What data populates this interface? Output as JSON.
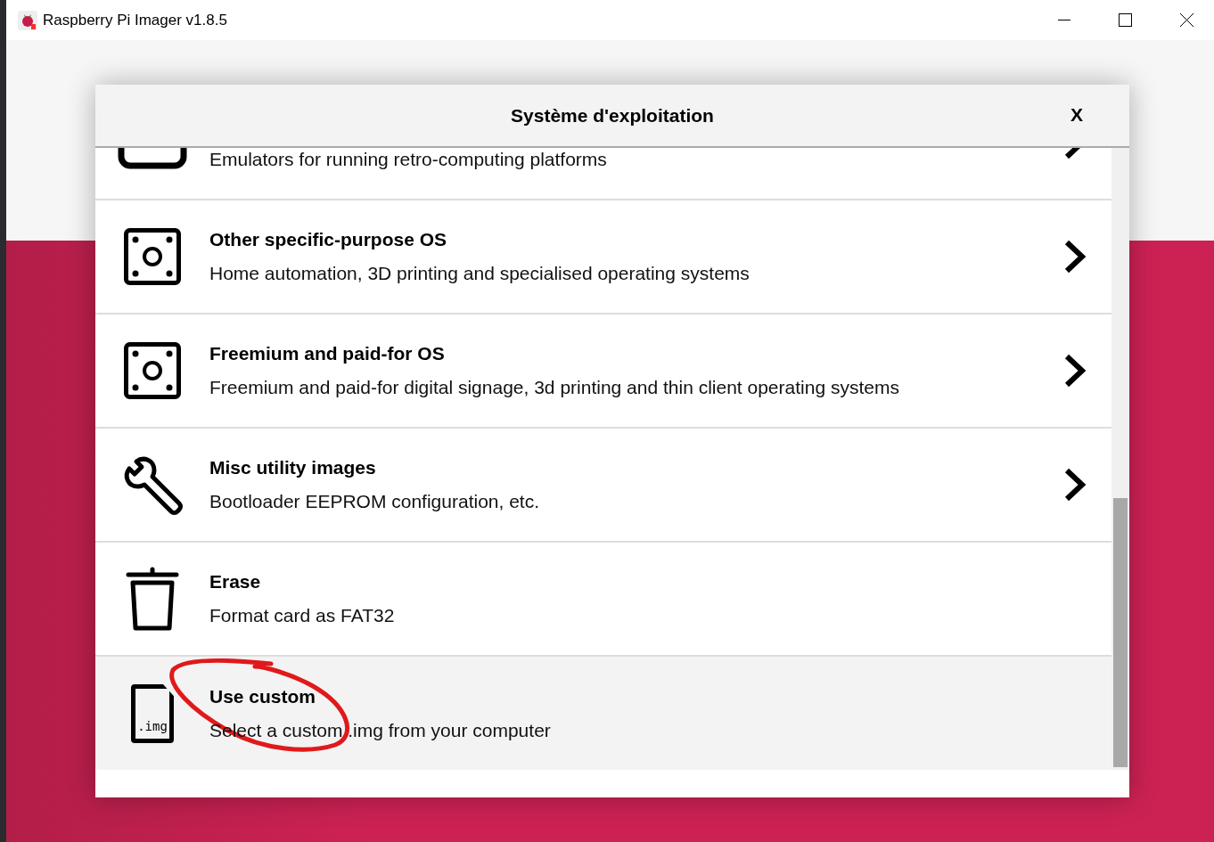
{
  "window": {
    "title": "Raspberry Pi Imager v1.8.5"
  },
  "dialog": {
    "title": "Système d'exploitation",
    "close_label": "X"
  },
  "items": [
    {
      "kind": "gamepad",
      "description": "Emulators for running retro-computing platforms",
      "has_submenu": true,
      "selected": false
    },
    {
      "kind": "board",
      "title": "Other specific-purpose OS",
      "description": "Home automation, 3D printing and specialised operating systems",
      "has_submenu": true,
      "selected": false
    },
    {
      "kind": "board",
      "title": "Freemium and paid-for OS",
      "description": "Freemium and paid-for digital signage, 3d printing and thin client operating systems",
      "has_submenu": true,
      "selected": false
    },
    {
      "kind": "wrench",
      "title": "Misc utility images",
      "description": "Bootloader EEPROM configuration, etc.",
      "has_submenu": true,
      "selected": false
    },
    {
      "kind": "trash",
      "title": "Erase",
      "description": "Format card as FAT32",
      "has_submenu": false,
      "selected": false
    },
    {
      "kind": "img",
      "title": "Use custom",
      "description": "Select a custom .img from your computer",
      "has_submenu": false,
      "selected": true,
      "icon_text": ".img"
    }
  ]
}
